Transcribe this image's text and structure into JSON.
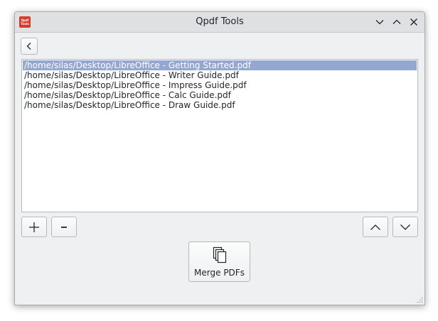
{
  "app": {
    "title": "Qpdf Tools",
    "icon_text": "Qpdf Tools",
    "icon": "qpdf-tools-app-icon",
    "icon_color": "#d63a2e"
  },
  "titlebar_buttons": [
    "minimize-icon",
    "maximize-icon",
    "close-icon"
  ],
  "toolbar": {
    "back_icon": "chevron-left-icon"
  },
  "files": [
    "/home/silas/Desktop/LibreOffice - Getting Started.pdf",
    "/home/silas/Desktop/LibreOffice - Writer Guide.pdf",
    "/home/silas/Desktop/LibreOffice - Impress Guide.pdf",
    "/home/silas/Desktop/LibreOffice - Calc Guide.pdf",
    "/home/silas/Desktop/LibreOffice - Draw Guide.pdf"
  ],
  "selected_index": 0,
  "selection_color": "#93a7d1",
  "list_buttons": {
    "add_icon": "plus-icon",
    "remove_icon": "minus-icon",
    "move_up_icon": "chevron-up-icon",
    "move_down_icon": "chevron-down-icon"
  },
  "merge": {
    "label": "Merge PDFs",
    "icon": "copy-documents-icon"
  }
}
